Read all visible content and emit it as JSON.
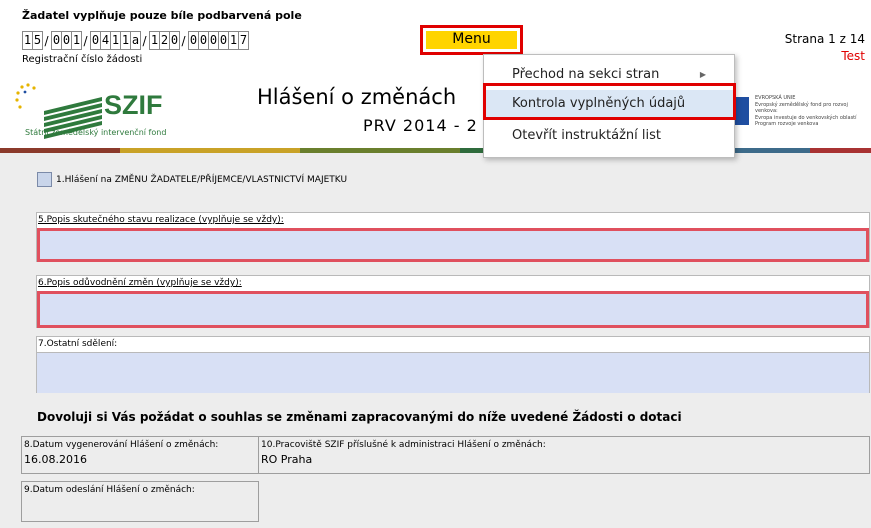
{
  "header": {
    "instruction": "Žadatel vyplňuje pouze bíle podbarvená pole",
    "reg_number_label": "Registrační číslo žádosti",
    "reg_number_groups": [
      [
        "1",
        "5"
      ],
      [
        "0",
        "0",
        "1"
      ],
      [
        "0",
        "4",
        "1",
        "1",
        "a"
      ],
      [
        "1",
        "2",
        "0"
      ],
      [
        "0",
        "0",
        "0",
        "0",
        "1",
        "7"
      ]
    ],
    "menu_label": "Menu",
    "page_info": "Strana 1 z 14",
    "mode": "Test"
  },
  "branding": {
    "logo_name": "SZIF",
    "logo_subtitle": "Státní zemědělský intervenční fond",
    "title": "Hlášení o změnách",
    "subtitle": "PRV 2014 - 2",
    "eu_text_lines": [
      "EVROPSKÁ UNIE",
      "Evropský zemědělský fond pro rozvoj venkova:",
      "Evropa investuje do venkovských oblastí",
      "Program rozvoje venkova"
    ],
    "stripe_colors": [
      "#8b3a2b",
      "#c9a227",
      "#6a7f2d",
      "#2f6b3c",
      "#0e4d2a",
      "#3d6b8a",
      "#a83232"
    ]
  },
  "menu_dropdown": {
    "items": [
      {
        "label": "Přechod na sekci stran",
        "has_submenu": true
      },
      {
        "label": "Kontrola vyplněných údajů",
        "selected": true
      },
      {
        "label": "Otevřít instruktážní list"
      }
    ]
  },
  "form": {
    "checkbox1_label": "1.Hlášení na ZMĚNU ŽADATELE/PŘÍJEMCE/VLASTNICTVÍ MAJETKU",
    "field5_label": "5.Popis skutečného stavu realizace (vyplňuje se vždy):",
    "field5_value": "",
    "field6_label": "6.Popis odůvodnění změn (vyplňuje se vždy):",
    "field6_value": "",
    "field7_label": "7.Ostatní sdělení:",
    "field7_value": "",
    "consent_heading": "Dovoluji si Vás požádat o souhlas se změnami zapracovanými do níže uvedené Žádosti o dotaci",
    "field8_label": "8.Datum vygenerování Hlášení o změnách:",
    "field8_value": "16.08.2016",
    "field10_label": "10.Pracoviště SZIF příslušné k administraci Hlášení o změnách:",
    "field10_value": "RO Praha",
    "field9_label": "9.Datum odeslání Hlášení o změnách:",
    "field9_value": ""
  },
  "colors": {
    "highlight_red": "#e00000",
    "menu_yellow": "#ffd400",
    "field_blue": "#d8e0f5",
    "required_border": "#e0505e",
    "szif_green": "#2f7a3d"
  }
}
